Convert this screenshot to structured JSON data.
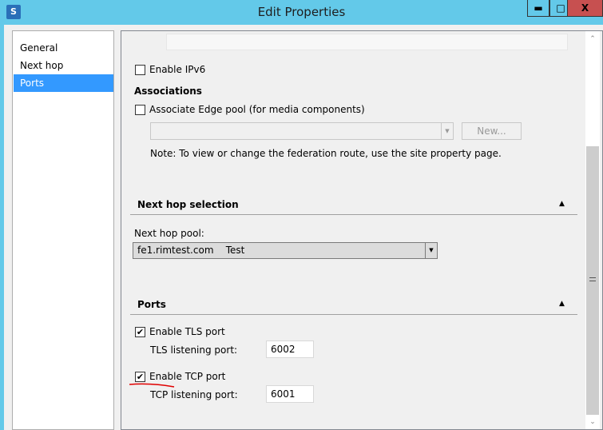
{
  "window": {
    "title": "Edit Properties",
    "minimize": "▬",
    "maximize": "□",
    "close": "X",
    "icon": "skype-topology-icon"
  },
  "nav": {
    "items": [
      {
        "label": "General"
      },
      {
        "label": "Next hop"
      },
      {
        "label": "Ports",
        "selected": true
      }
    ]
  },
  "main": {
    "enable_ipv6": {
      "label": "Enable IPv6",
      "checked": false
    },
    "associations": {
      "title": "Associations",
      "edge_pool": {
        "label": "Associate Edge pool (for media components)",
        "checked": false
      },
      "dropdown_value": "",
      "new_button": "New...",
      "note": "Note: To view or change the federation route, use the site property page."
    },
    "next_hop": {
      "title": "Next hop selection",
      "pool_label": "Next hop pool:",
      "pool_value": "fe1.rimtest.com    Test"
    },
    "ports": {
      "title": "Ports",
      "tls": {
        "label": "Enable TLS port",
        "checked": true,
        "port_label": "TLS listening port:",
        "port": "6002"
      },
      "tcp": {
        "label": "Enable TCP port",
        "checked": true,
        "port_label": "TCP listening port:",
        "port": "6001"
      }
    },
    "check": "✔",
    "collapse": "▲",
    "dropdown_arrow": "▼"
  },
  "colors": {
    "titlebar": "#63c9e9",
    "selection": "#3399ff",
    "close": "#c75050",
    "annotation": "#e00000"
  }
}
